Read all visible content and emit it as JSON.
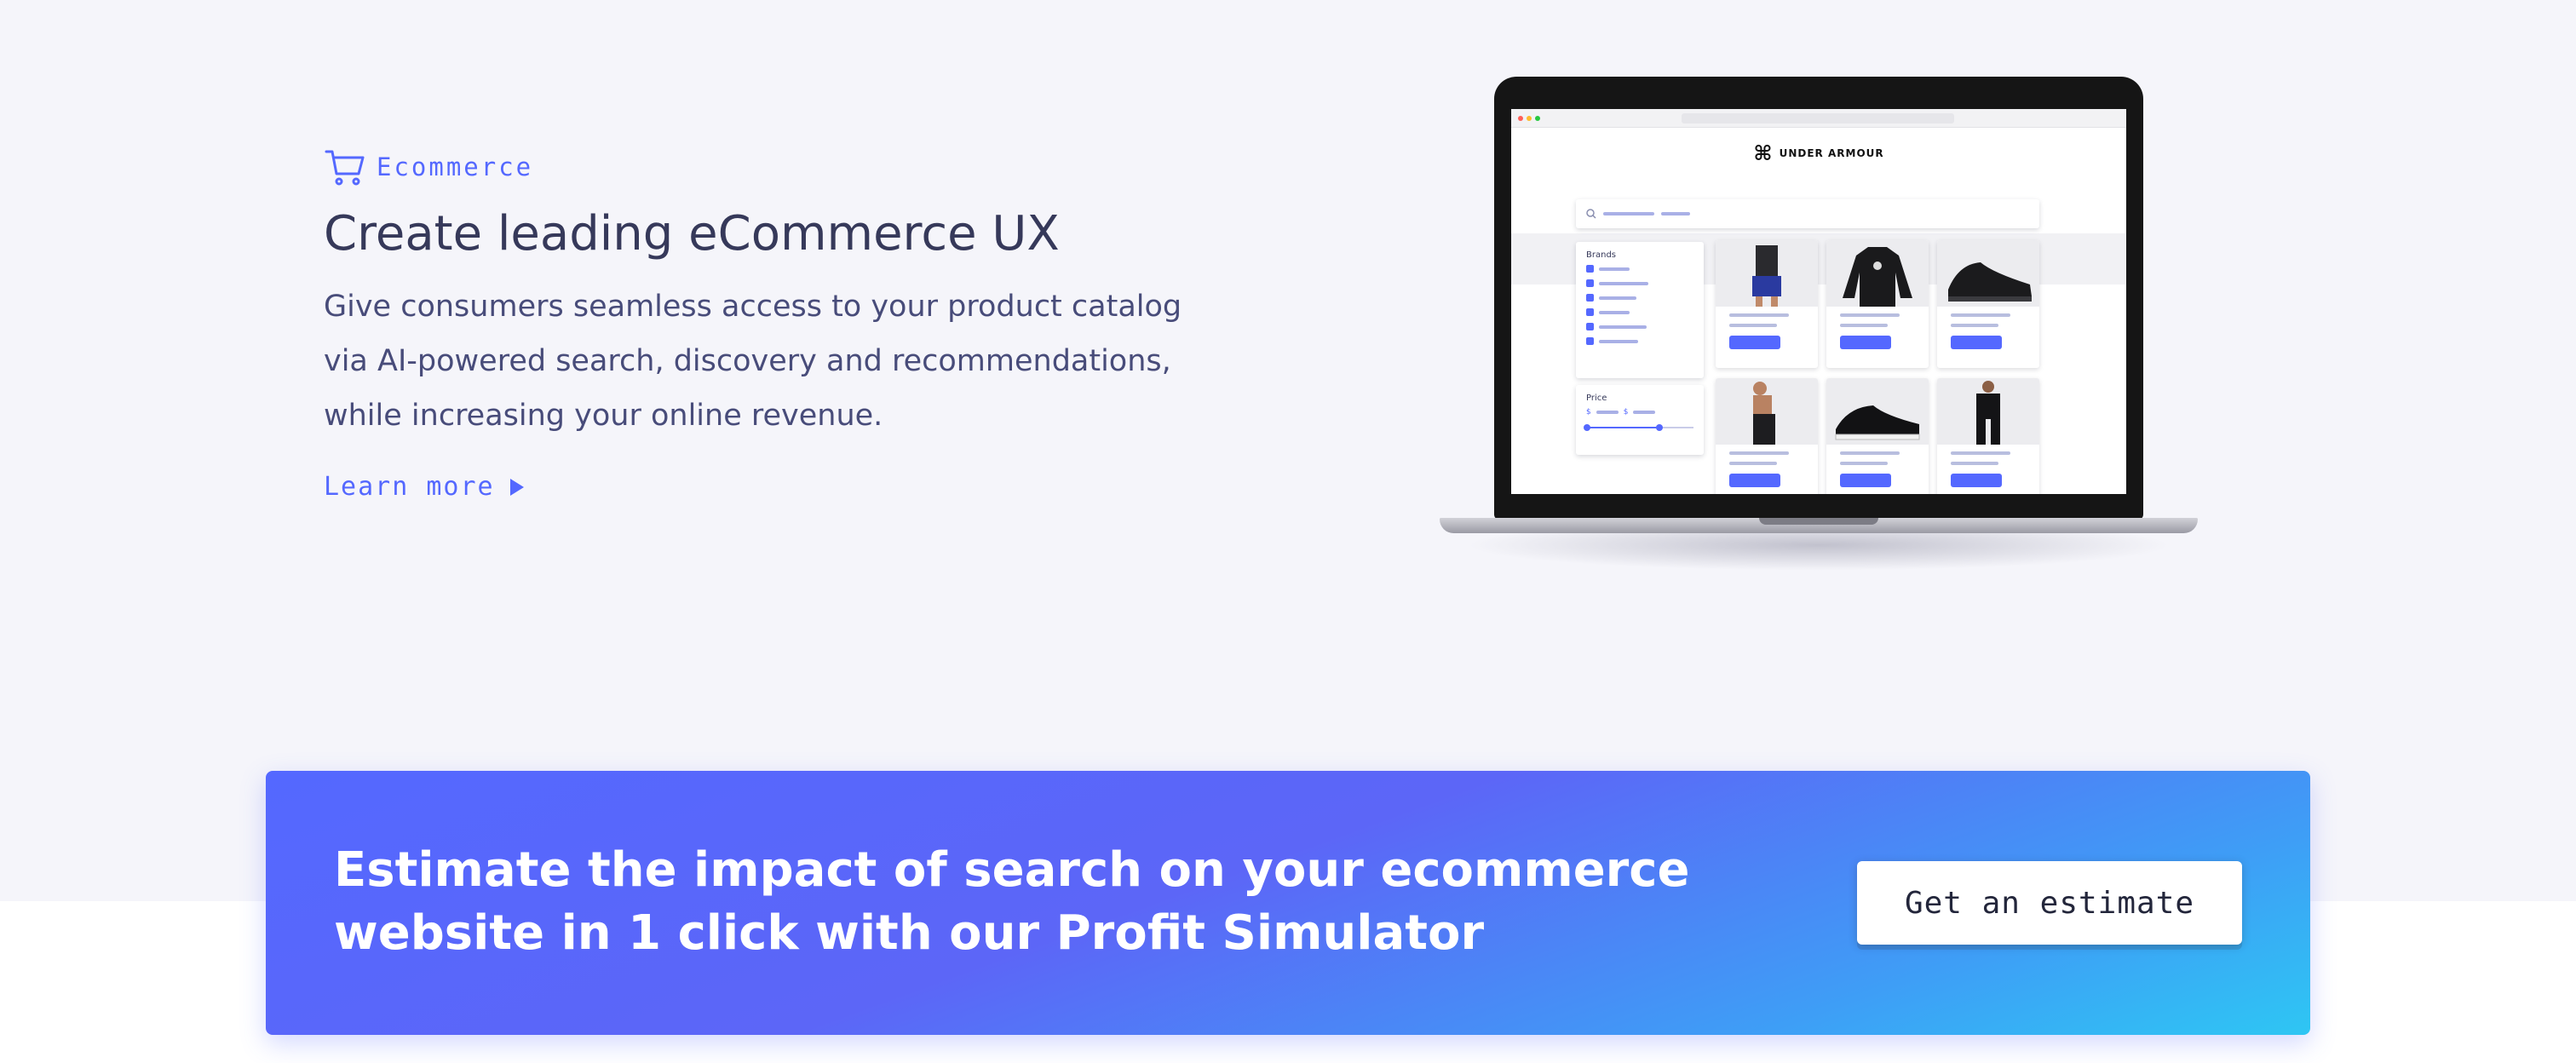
{
  "hero": {
    "eyebrow": "Ecommerce",
    "eyebrow_icon": "shopping-cart-icon",
    "title": "Create leading eCommerce UX",
    "description": "Give consumers seamless access to your product catalog via AI-powered search, discovery and recommendations, while increasing your online revenue.",
    "learn_more": "Learn more",
    "accent_color": "#5468ff"
  },
  "laptop": {
    "brand": "UNDER ARMOUR",
    "facets": {
      "brands_title": "Brands",
      "price_title": "Price",
      "price_from_symbol": "$",
      "price_to_symbol": "$"
    }
  },
  "banner": {
    "text": "Estimate the impact of search on your ecommerce website in 1 click with our Profit Simulator",
    "button": "Get an estimate",
    "gradient_start": "#5468ff",
    "gradient_end": "#2ec6f3"
  }
}
